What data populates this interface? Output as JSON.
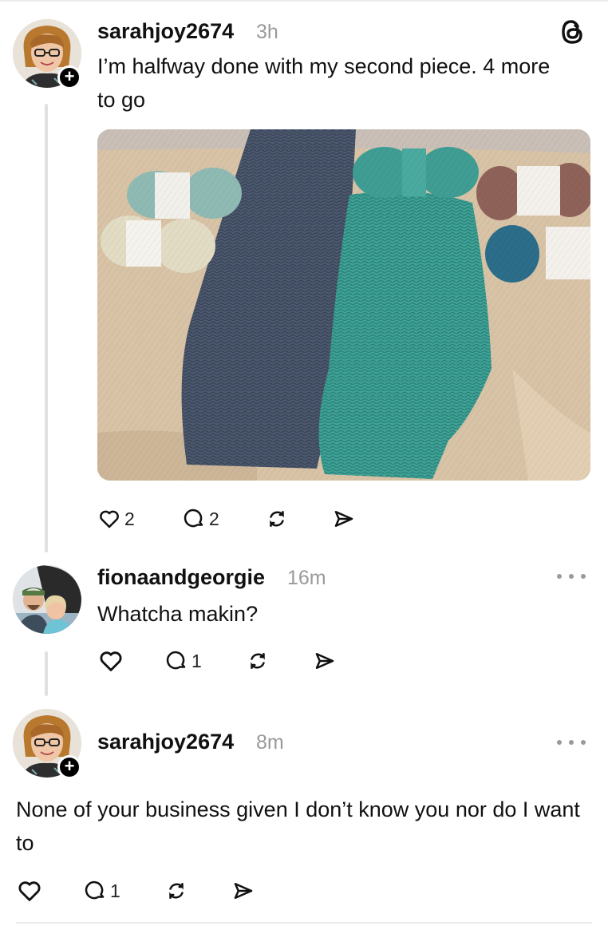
{
  "posts": [
    {
      "username": "sarahjoy2674",
      "time": "3h",
      "text": "I’m halfway done with my second piece. 4 more to go",
      "likes": "2",
      "replies": "2",
      "icon": "threads-logo-icon"
    },
    {
      "username": "fionaandgeorgie",
      "time": "16m",
      "text": "Whatcha makin?",
      "likes": "",
      "replies": "1"
    },
    {
      "username": "sarahjoy2674",
      "time": "8m",
      "text": "None of your business given I don’t know you nor do I want to",
      "likes": "",
      "replies": "1"
    }
  ],
  "icons": {
    "follow": "+",
    "like": "heart-icon",
    "reply": "comment-bubble-icon",
    "repost": "repost-icon",
    "share": "send-icon",
    "more": "more-options-icon"
  },
  "colors": {
    "text": "#111111",
    "muted": "#9a9a9a",
    "thread_line": "#e1e1e1",
    "badge": "#000000"
  }
}
